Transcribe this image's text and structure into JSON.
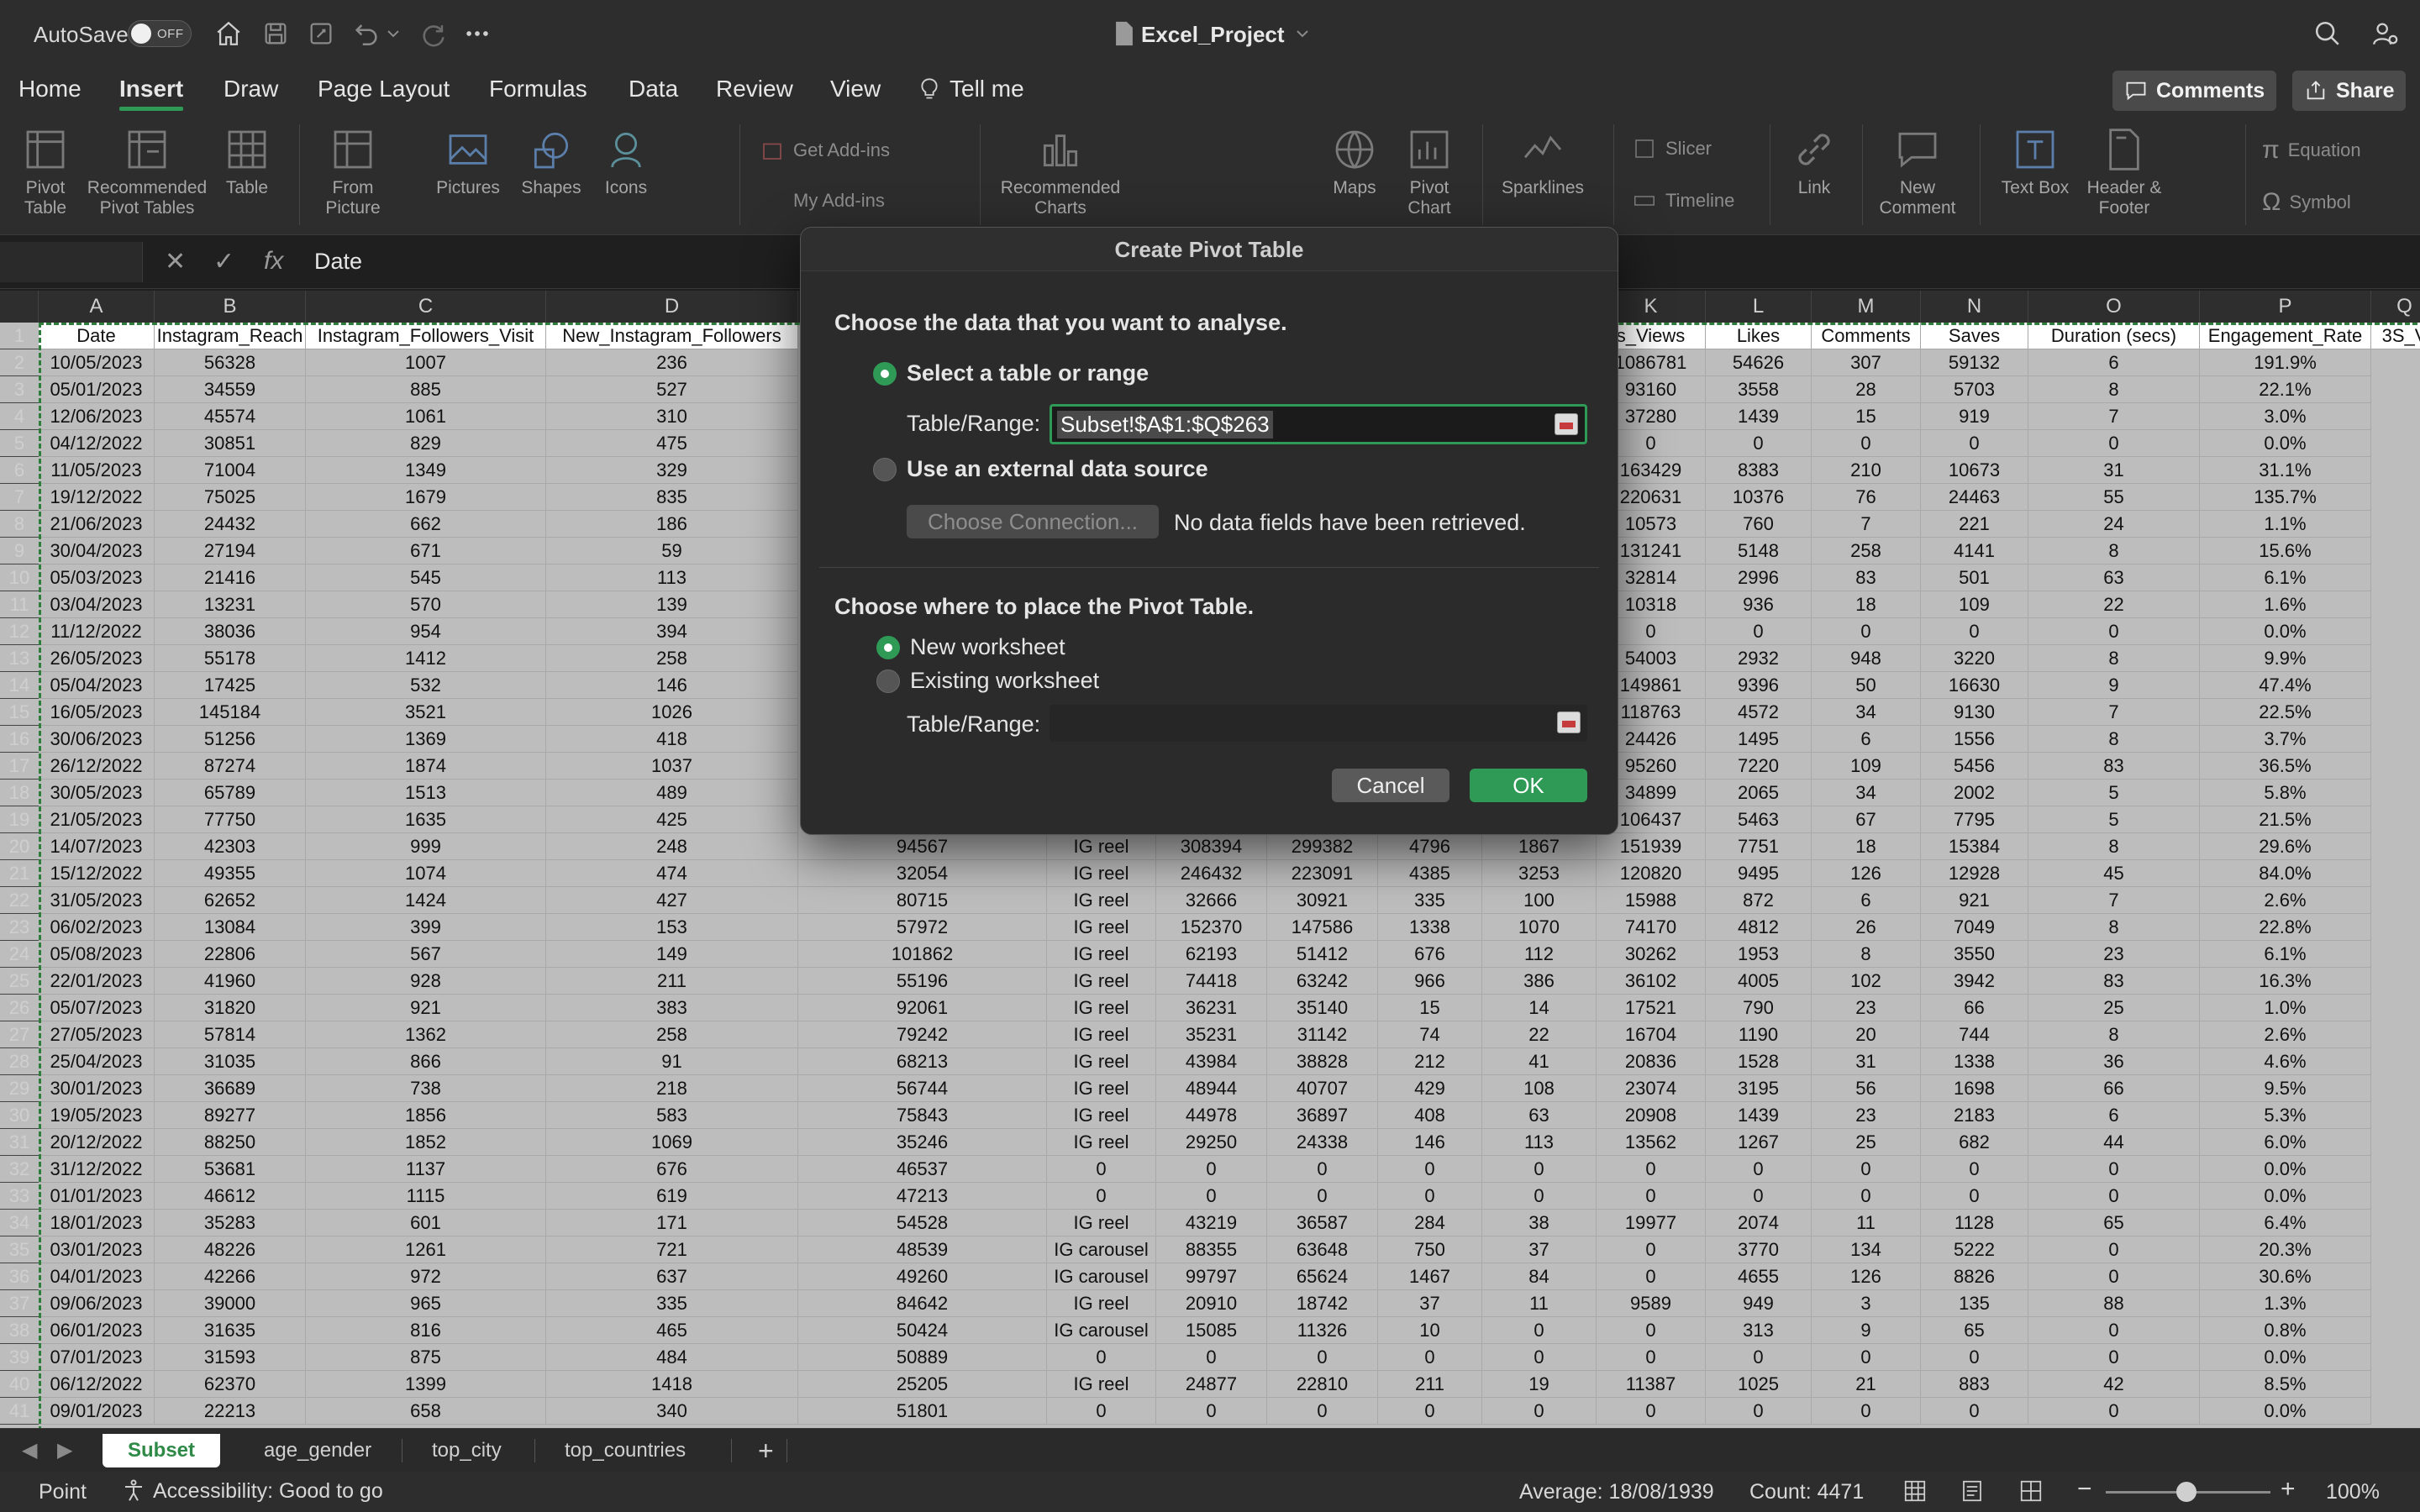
{
  "titlebar": {
    "autosave_label": "AutoSave",
    "autosave_state": "OFF",
    "doc_title": "Excel_Project"
  },
  "tabs": [
    "Home",
    "Insert",
    "Draw",
    "Page Layout",
    "Formulas",
    "Data",
    "Review",
    "View",
    "Tell me"
  ],
  "active_tab": "Insert",
  "header_buttons": {
    "comments": "Comments",
    "share": "Share"
  },
  "ribbon": {
    "pivot_table": "Pivot Table",
    "recommended_pivot": "Recommended Pivot Tables",
    "table": "Table",
    "from_picture": "From Picture",
    "pictures": "Pictures",
    "shapes": "Shapes",
    "icons": "Icons",
    "get_addins": "Get Add-ins",
    "my_addins": "My Add-ins",
    "recommended_charts": "Recommended Charts",
    "maps": "Maps",
    "pivot_chart": "Pivot Chart",
    "sparklines": "Sparklines",
    "slicer": "Slicer",
    "timeline": "Timeline",
    "link": "Link",
    "new_comment": "New Comment",
    "text_box": "Text Box",
    "header_footer": "Header & Footer",
    "equation": "Equation",
    "symbol": "Symbol"
  },
  "formula_bar": {
    "fx": "fx",
    "content": "Date"
  },
  "columns": [
    "A",
    "B",
    "C",
    "D",
    "K",
    "L",
    "M",
    "N",
    "O",
    "P",
    "Q"
  ],
  "header_row": [
    "Date",
    "Instagram_Reach",
    "Instagram_Followers_Visit",
    "New_Instagram_Followers",
    "s_Views",
    "Likes",
    "Comments",
    "Saves",
    "Duration (secs)",
    "Engagement_Rate",
    "3S_V"
  ],
  "rows_left": [
    [
      "10/05/2023",
      "56328",
      "1007",
      "236"
    ],
    [
      "05/01/2023",
      "34559",
      "885",
      "527"
    ],
    [
      "12/06/2023",
      "45574",
      "1061",
      "310"
    ],
    [
      "04/12/2022",
      "30851",
      "829",
      "475"
    ],
    [
      "11/05/2023",
      "71004",
      "1349",
      "329"
    ],
    [
      "19/12/2022",
      "75025",
      "1679",
      "835"
    ],
    [
      "21/06/2023",
      "24432",
      "662",
      "186"
    ],
    [
      "30/04/2023",
      "27194",
      "671",
      "59"
    ],
    [
      "05/03/2023",
      "21416",
      "545",
      "113"
    ],
    [
      "03/04/2023",
      "13231",
      "570",
      "139"
    ],
    [
      "11/12/2022",
      "38036",
      "954",
      "394"
    ],
    [
      "26/05/2023",
      "55178",
      "1412",
      "258"
    ],
    [
      "05/04/2023",
      "17425",
      "532",
      "146"
    ],
    [
      "16/05/2023",
      "145184",
      "3521",
      "1026"
    ],
    [
      "30/06/2023",
      "51256",
      "1369",
      "418"
    ],
    [
      "26/12/2022",
      "87274",
      "1874",
      "1037"
    ],
    [
      "30/05/2023",
      "65789",
      "1513",
      "489"
    ],
    [
      "21/05/2023",
      "77750",
      "1635",
      "425"
    ],
    [
      "14/07/2023",
      "42303",
      "999",
      "248"
    ],
    [
      "15/12/2022",
      "49355",
      "1074",
      "474"
    ],
    [
      "31/05/2023",
      "62652",
      "1424",
      "427"
    ],
    [
      "06/02/2023",
      "13084",
      "399",
      "153"
    ],
    [
      "05/08/2023",
      "22806",
      "567",
      "149"
    ],
    [
      "22/01/2023",
      "41960",
      "928",
      "211"
    ],
    [
      "05/07/2023",
      "31820",
      "921",
      "383"
    ],
    [
      "27/05/2023",
      "57814",
      "1362",
      "258"
    ],
    [
      "25/04/2023",
      "31035",
      "866",
      "91"
    ],
    [
      "30/01/2023",
      "36689",
      "738",
      "218"
    ],
    [
      "19/05/2023",
      "89277",
      "1856",
      "583"
    ],
    [
      "20/12/2022",
      "88250",
      "1852",
      "1069"
    ],
    [
      "31/12/2022",
      "53681",
      "1137",
      "676"
    ],
    [
      "01/01/2023",
      "46612",
      "1115",
      "619"
    ],
    [
      "18/01/2023",
      "35283",
      "601",
      "171"
    ],
    [
      "03/01/2023",
      "48226",
      "1261",
      "721"
    ],
    [
      "04/01/2023",
      "42266",
      "972",
      "637"
    ],
    [
      "09/06/2023",
      "39000",
      "965",
      "335"
    ],
    [
      "06/01/2023",
      "31635",
      "816",
      "465"
    ],
    [
      "07/01/2023",
      "31593",
      "875",
      "484"
    ],
    [
      "06/12/2022",
      "62370",
      "1399",
      "1418"
    ],
    [
      "09/01/2023",
      "22213",
      "658",
      "340"
    ]
  ],
  "rows_mid_visible_from": 19,
  "rows_mid": [
    [
      "94567",
      "IG reel",
      "308394",
      "299382",
      "4796",
      "1867"
    ],
    [
      "32054",
      "IG reel",
      "246432",
      "223091",
      "4385",
      "3253"
    ],
    [
      "80715",
      "IG reel",
      "32666",
      "30921",
      "335",
      "100"
    ],
    [
      "57972",
      "IG reel",
      "152370",
      "147586",
      "1338",
      "1070"
    ],
    [
      "101862",
      "IG reel",
      "62193",
      "51412",
      "676",
      "112"
    ],
    [
      "55196",
      "IG reel",
      "74418",
      "63242",
      "966",
      "386"
    ],
    [
      "92061",
      "IG reel",
      "36231",
      "35140",
      "15",
      "14"
    ],
    [
      "79242",
      "IG reel",
      "35231",
      "31142",
      "74",
      "22"
    ],
    [
      "68213",
      "IG reel",
      "43984",
      "38828",
      "212",
      "41"
    ],
    [
      "56744",
      "IG reel",
      "48944",
      "40707",
      "429",
      "108"
    ],
    [
      "75843",
      "IG reel",
      "44978",
      "36897",
      "408",
      "63"
    ],
    [
      "35246",
      "IG reel",
      "29250",
      "24338",
      "146",
      "113"
    ],
    [
      "46537",
      "0",
      "0",
      "0",
      "0",
      "0"
    ],
    [
      "47213",
      "0",
      "0",
      "0",
      "0",
      "0"
    ],
    [
      "54528",
      "IG reel",
      "43219",
      "36587",
      "284",
      "38"
    ],
    [
      "48539",
      "IG carousel",
      "88355",
      "63648",
      "750",
      "37"
    ],
    [
      "49260",
      "IG carousel",
      "99797",
      "65624",
      "1467",
      "84"
    ],
    [
      "84642",
      "IG reel",
      "20910",
      "18742",
      "37",
      "11"
    ],
    [
      "50424",
      "IG carousel",
      "15085",
      "11326",
      "10",
      "0"
    ],
    [
      "50889",
      "0",
      "0",
      "0",
      "0",
      "0"
    ],
    [
      "25205",
      "IG reel",
      "24877",
      "22810",
      "211",
      "19"
    ],
    [
      "51801",
      "0",
      "0",
      "0",
      "0",
      "0"
    ]
  ],
  "rows_right": [
    [
      "1086781",
      "54626",
      "307",
      "59132",
      "6",
      "191.9%"
    ],
    [
      "93160",
      "3558",
      "28",
      "5703",
      "8",
      "22.1%"
    ],
    [
      "37280",
      "1439",
      "15",
      "919",
      "7",
      "3.0%"
    ],
    [
      "0",
      "0",
      "0",
      "0",
      "0",
      "0.0%"
    ],
    [
      "163429",
      "8383",
      "210",
      "10673",
      "31",
      "31.1%"
    ],
    [
      "220631",
      "10376",
      "76",
      "24463",
      "55",
      "135.7%"
    ],
    [
      "10573",
      "760",
      "7",
      "221",
      "24",
      "1.1%"
    ],
    [
      "131241",
      "5148",
      "258",
      "4141",
      "8",
      "15.6%"
    ],
    [
      "32814",
      "2996",
      "83",
      "501",
      "63",
      "6.1%"
    ],
    [
      "10318",
      "936",
      "18",
      "109",
      "22",
      "1.6%"
    ],
    [
      "0",
      "0",
      "0",
      "0",
      "0",
      "0.0%"
    ],
    [
      "54003",
      "2932",
      "948",
      "3220",
      "8",
      "9.9%"
    ],
    [
      "149861",
      "9396",
      "50",
      "16630",
      "9",
      "47.4%"
    ],
    [
      "118763",
      "4572",
      "34",
      "9130",
      "7",
      "22.5%"
    ],
    [
      "24426",
      "1495",
      "6",
      "1556",
      "8",
      "3.7%"
    ],
    [
      "95260",
      "7220",
      "109",
      "5456",
      "83",
      "36.5%"
    ],
    [
      "34899",
      "2065",
      "34",
      "2002",
      "5",
      "5.8%"
    ],
    [
      "106437",
      "5463",
      "67",
      "7795",
      "5",
      "21.5%"
    ],
    [
      "151939",
      "7751",
      "18",
      "15384",
      "8",
      "29.6%"
    ],
    [
      "120820",
      "9495",
      "126",
      "12928",
      "45",
      "84.0%"
    ],
    [
      "15988",
      "872",
      "6",
      "921",
      "7",
      "2.6%"
    ],
    [
      "74170",
      "4812",
      "26",
      "7049",
      "8",
      "22.8%"
    ],
    [
      "30262",
      "1953",
      "8",
      "3550",
      "23",
      "6.1%"
    ],
    [
      "36102",
      "4005",
      "102",
      "3942",
      "83",
      "16.3%"
    ],
    [
      "17521",
      "790",
      "23",
      "66",
      "25",
      "1.0%"
    ],
    [
      "16704",
      "1190",
      "20",
      "744",
      "8",
      "2.6%"
    ],
    [
      "20836",
      "1528",
      "31",
      "1338",
      "36",
      "4.6%"
    ],
    [
      "23074",
      "3195",
      "56",
      "1698",
      "66",
      "9.5%"
    ],
    [
      "20908",
      "1439",
      "23",
      "2183",
      "6",
      "5.3%"
    ],
    [
      "13562",
      "1267",
      "25",
      "682",
      "44",
      "6.0%"
    ],
    [
      "0",
      "0",
      "0",
      "0",
      "0",
      "0.0%"
    ],
    [
      "0",
      "0",
      "0",
      "0",
      "0",
      "0.0%"
    ],
    [
      "19977",
      "2074",
      "11",
      "1128",
      "65",
      "6.4%"
    ],
    [
      "0",
      "3770",
      "134",
      "5222",
      "0",
      "20.3%"
    ],
    [
      "0",
      "4655",
      "126",
      "8826",
      "0",
      "30.6%"
    ],
    [
      "9589",
      "949",
      "3",
      "135",
      "88",
      "1.3%"
    ],
    [
      "0",
      "313",
      "9",
      "65",
      "0",
      "0.8%"
    ],
    [
      "0",
      "0",
      "0",
      "0",
      "0",
      "0.0%"
    ],
    [
      "11387",
      "1025",
      "21",
      "883",
      "42",
      "8.5%"
    ],
    [
      "0",
      "0",
      "0",
      "0",
      "0",
      "0.0%"
    ]
  ],
  "sheet_tabs": [
    "Subset",
    "age_gender",
    "top_city",
    "top_countries"
  ],
  "active_sheet": "Subset",
  "statusbar": {
    "mode": "Point",
    "accessibility": "Accessibility: Good to go",
    "average": "Average: 18/08/1939",
    "count": "Count: 4471",
    "zoom": "100%"
  },
  "dialog": {
    "title": "Create Pivot Table",
    "section1": "Choose the data that you want to analyse.",
    "opt_table": "Select a table or range",
    "table_range_label": "Table/Range:",
    "table_range_value": "Subset!$A$1:$Q$263",
    "opt_external": "Use an external data source",
    "choose_connection": "Choose Connection...",
    "no_data": "No data fields have been retrieved.",
    "section2": "Choose where to place the Pivot Table.",
    "opt_new_ws": "New worksheet",
    "opt_existing_ws": "Existing worksheet",
    "table_range_label2": "Table/Range:",
    "cancel": "Cancel",
    "ok": "OK"
  },
  "colors": {
    "accent": "#2f9a56",
    "ribbon_bg": "#2d2d2d",
    "grid_dim": "#bdbdbd"
  }
}
